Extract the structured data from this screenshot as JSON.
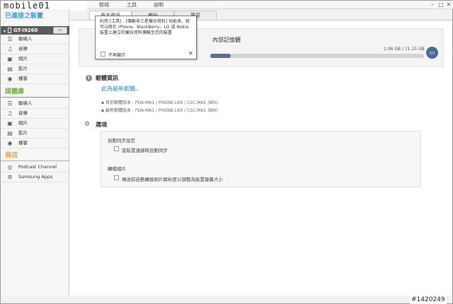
{
  "menu": {
    "items": [
      "檢視",
      "工具",
      "說明"
    ]
  },
  "logo": "mobile01",
  "window_controls": {
    "min": "–",
    "max": "□",
    "close": "✕"
  },
  "sidebar": {
    "connected_title": "已連接之裝置",
    "device_name": "GT-I9260",
    "device_button": "▭",
    "device_items": [
      "聯絡人",
      "音樂",
      "相片",
      "影片",
      "播客"
    ],
    "library_title": "媒體庫",
    "library_items": [
      "聯絡人",
      "音樂",
      "相片",
      "影片",
      "播客"
    ],
    "store_title": "商店",
    "store_items": [
      "Podcast Channel",
      "Samsung Apps"
    ]
  },
  "tabs": [
    "基本資訊",
    "備份",
    "還原"
  ],
  "memory": {
    "label": "內部記憶體",
    "value": "1.06 GB / 11.15 GB",
    "used_fraction": 0.095
  },
  "firmware": {
    "title": "韌體資訊",
    "status": "此為最新韌體。",
    "current": "目前韌體版本 : PDA:MA1 / PHONE:LK9 / CSC:MA1 (BRI)",
    "latest": "最新韌體版本 : PDA:MA1 / PHONE:LK9 / CSC:MA1 (BRI)"
  },
  "options": {
    "title": "選項",
    "auto_sync_title": "自動同步設定",
    "auto_sync_label": "當裝置連線時自動同步",
    "photo_title": "轉檔相片",
    "photo_label": "傳送前自動轉換相片解析度以調整為裝置螢幕大小"
  },
  "tooltip": {
    "text": "利用 [工具] - [傳輸非三星備份資料] 功能表，就可以將在 iPhone、BlackBerry、LG 或 Nokia 裝置上建立的備份資料傳輸至您的裝置",
    "dont_show": "不再顯示",
    "close": "✕"
  },
  "watermark": "#1420249",
  "colors": {
    "connected": "#3a9fcf",
    "library": "#6fae3a",
    "store": "#e8a23a",
    "accent": "#2a8fb8"
  }
}
